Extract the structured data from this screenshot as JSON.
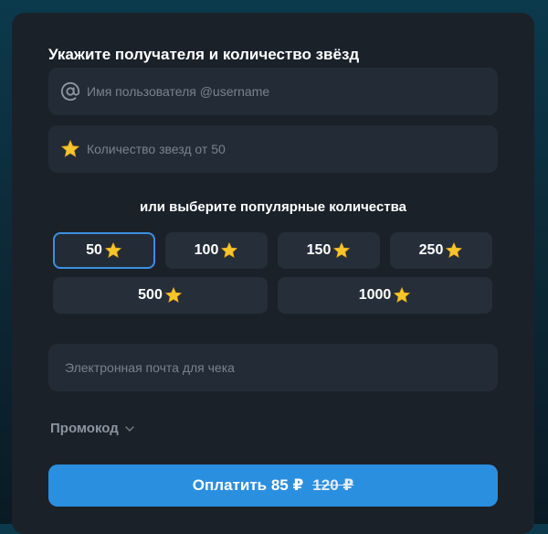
{
  "form": {
    "title": "Укажите получателя и количество звёзд",
    "username_placeholder": "Имя пользователя @username",
    "stars_placeholder": "Количество звезд от 50",
    "popular_title": "или выберите популярные количества",
    "email_placeholder": "Электронная почта для чека",
    "promo_label": "Промокод",
    "pay_label": "Оплатить 85 ₽",
    "pay_old_price": "120 ₽"
  },
  "presets": [
    {
      "label": "50",
      "selected": true
    },
    {
      "label": "100",
      "selected": false
    },
    {
      "label": "150",
      "selected": false
    },
    {
      "label": "250",
      "selected": false
    },
    {
      "label": "500",
      "selected": false
    },
    {
      "label": "1000",
      "selected": false
    }
  ],
  "colors": {
    "accent": "#2b8fe0",
    "star": "#f7c52b",
    "card": "#1b2129",
    "field": "#232c36"
  },
  "icons": {
    "username": "at-icon",
    "stars": "star-icon",
    "promo": "chevron-down-icon"
  }
}
